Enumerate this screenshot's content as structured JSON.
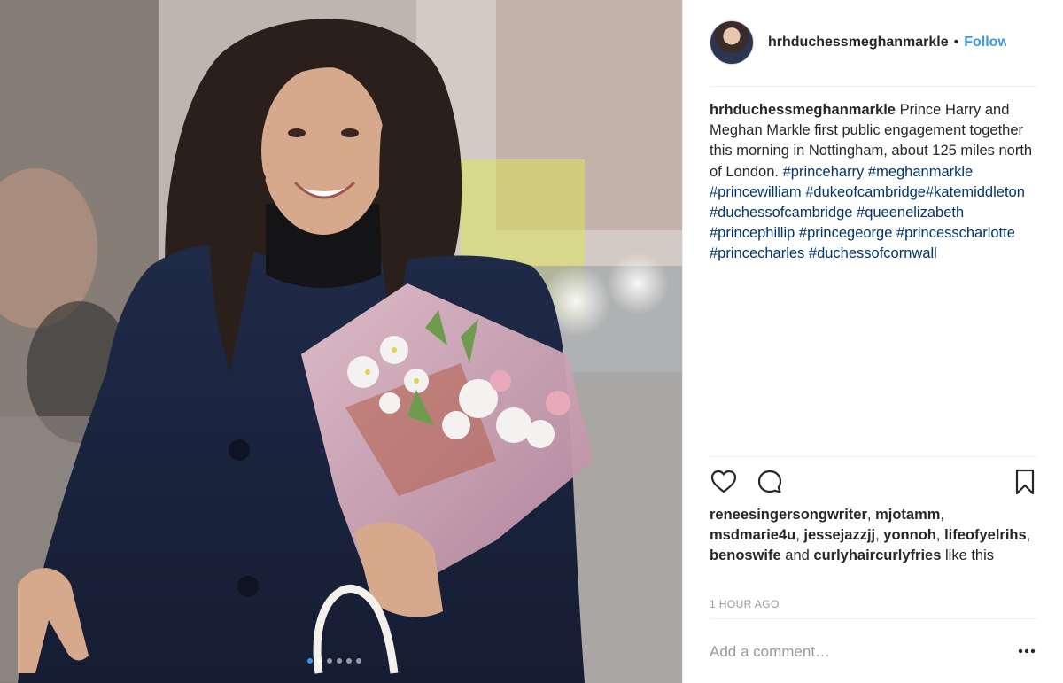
{
  "header": {
    "username": "hrhduchessmeghanmarkle",
    "separator": "•",
    "follow_label": "Follow"
  },
  "caption": {
    "username": "hrhduchessmeghanmarkle",
    "text": "Prince Harry and Meghan Markle first public engagement together this morning in Nottingham, about 125 miles north of London.",
    "hashtags": [
      "#princeharry",
      "#meghanmarkle",
      "#princewilliam",
      "#dukeofcambridge",
      "#katemiddleton",
      "#duchessofcambridge",
      "#queenelizabeth",
      "#princephillip",
      "#princegeorge",
      "#princesscharlotte",
      "#princecharles",
      "#duchessofcornwall"
    ]
  },
  "likes": {
    "users": [
      "reneesingersongwriter",
      "mjotamm",
      "msdmarie4u",
      "jessejazzjj",
      "yonnoh",
      "lifeofyelrihs",
      "benoswife",
      "curlyhaircurlyfries"
    ],
    "and": "and",
    "suffix": "like this"
  },
  "timestamp": "1 HOUR AGO",
  "comment": {
    "placeholder": "Add a comment…"
  },
  "icons": [
    "heart-icon",
    "comment-icon",
    "bookmark-icon",
    "more-options-icon"
  ],
  "carousel": {
    "count": 6,
    "active_index": 0
  },
  "colors": {
    "link": "#003569",
    "follow": "#3897f0",
    "muted": "#999999",
    "text": "#262626"
  }
}
